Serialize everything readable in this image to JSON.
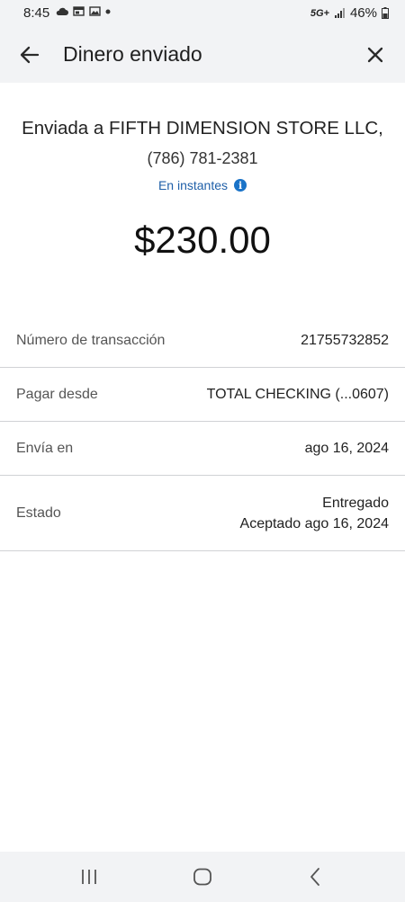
{
  "status_bar": {
    "time": "8:45",
    "network": "5G+",
    "battery": "46%"
  },
  "header": {
    "title": "Dinero enviado"
  },
  "recipient": {
    "prefix": "Enviada a ",
    "name": "FIFTH DIMENSION STORE LLC,",
    "phone": "(786) 781-2381",
    "speed": "En instantes",
    "info_icon_glyph": "i"
  },
  "amount": "$230.00",
  "details": {
    "transaction": {
      "label": "Número de transacción",
      "value": "21755732852"
    },
    "pay_from": {
      "label": "Pagar desde",
      "value": "TOTAL CHECKING (...0607)"
    },
    "send_on": {
      "label": "Envía en",
      "value": "ago 16, 2024"
    },
    "status": {
      "label": "Estado",
      "value_line1": "Entregado",
      "value_line2": "Aceptado ago 16, 2024"
    }
  },
  "colors": {
    "header_bg": "#f2f3f5",
    "link_blue": "#1f5fa8",
    "info_blue": "#1a73c8",
    "divider": "#d0d2d5"
  },
  "icons": {
    "back": "arrow-left-icon",
    "close": "close-icon",
    "nav_recents": "recents-icon",
    "nav_home": "home-icon",
    "nav_back": "chevron-left-icon"
  }
}
